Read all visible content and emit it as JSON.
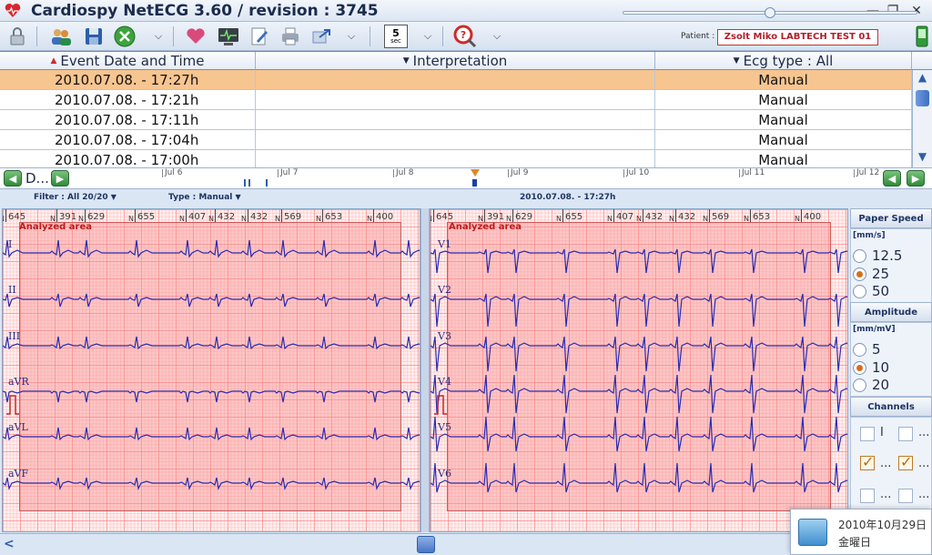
{
  "titlebar": {
    "title": "Cardiospy NetECG 3.60 / revision : 3745"
  },
  "toolbar": {
    "speed_btn_number": "5",
    "speed_btn_unit": "sec",
    "patient_label": "Patient :",
    "patient_name": "Zsolt Miko LABTECH TEST 01"
  },
  "grid": {
    "columns": [
      {
        "label": "Event Date and Time",
        "sort": "▲"
      },
      {
        "label": "Interpretation",
        "sort": "▼"
      },
      {
        "label": "Ecg type : All",
        "sort": "▼"
      }
    ],
    "rows": [
      {
        "datetime": "2010.07.08. - 17:27h",
        "interpretation": "",
        "ecg_type": "Manual",
        "selected": true
      },
      {
        "datetime": "2010.07.08. - 17:21h",
        "interpretation": "",
        "ecg_type": "Manual",
        "selected": false
      },
      {
        "datetime": "2010.07.08. - 17:11h",
        "interpretation": "",
        "ecg_type": "Manual",
        "selected": false
      },
      {
        "datetime": "2010.07.08. - 17:04h",
        "interpretation": "",
        "ecg_type": "Manual",
        "selected": false
      },
      {
        "datetime": "2010.07.08. - 17:00h",
        "interpretation": "",
        "ecg_type": "Manual",
        "selected": false
      }
    ]
  },
  "timeline": {
    "left_label": "D...",
    "day_labels": [
      "Jul 6",
      "Jul 7",
      "Jul 8",
      "Jul 9",
      "Jul 10",
      "Jul 11",
      "Jul 12"
    ]
  },
  "filterbar": {
    "filter": "Filter : All 20/20",
    "type": "Type : Manual",
    "timestamp": "2010.07.08. - 17:27h"
  },
  "ecg": {
    "analyzed_label": "Analyzed area",
    "ruler_numbers": [
      "645",
      "391",
      "629",
      "655",
      "407",
      "432",
      "432",
      "569",
      "653",
      "400"
    ],
    "ruler_marks": [
      "N",
      "N",
      "N",
      "N",
      "N",
      "N",
      "N",
      "N",
      "N",
      "N"
    ],
    "left_leads": [
      "I",
      "II",
      "III",
      "aVR",
      "aVL",
      "aVF"
    ],
    "right_leads": [
      "V1",
      "V2",
      "V3",
      "V4",
      "V5",
      "V6"
    ]
  },
  "panel": {
    "paper_speed": {
      "title": "Paper Speed",
      "unit": "[mm/s]",
      "options": [
        "12.5",
        "25",
        "50"
      ],
      "selected": "25"
    },
    "amplitude": {
      "title": "Amplitude",
      "unit": "[mm/mV]",
      "options": [
        "5",
        "10",
        "20"
      ],
      "selected": "10"
    },
    "channels": {
      "title": "Channels",
      "labels": [
        "I",
        "...",
        "...",
        "...",
        "...",
        "..."
      ]
    }
  },
  "clock": {
    "date": "2010年10月29日",
    "day": "金曜日"
  },
  "colors": {
    "selected_row": "#f7c590",
    "analyzed_area": "#f88c8c",
    "trace": "#2b2bb0",
    "patient_border": "#c4343c"
  }
}
